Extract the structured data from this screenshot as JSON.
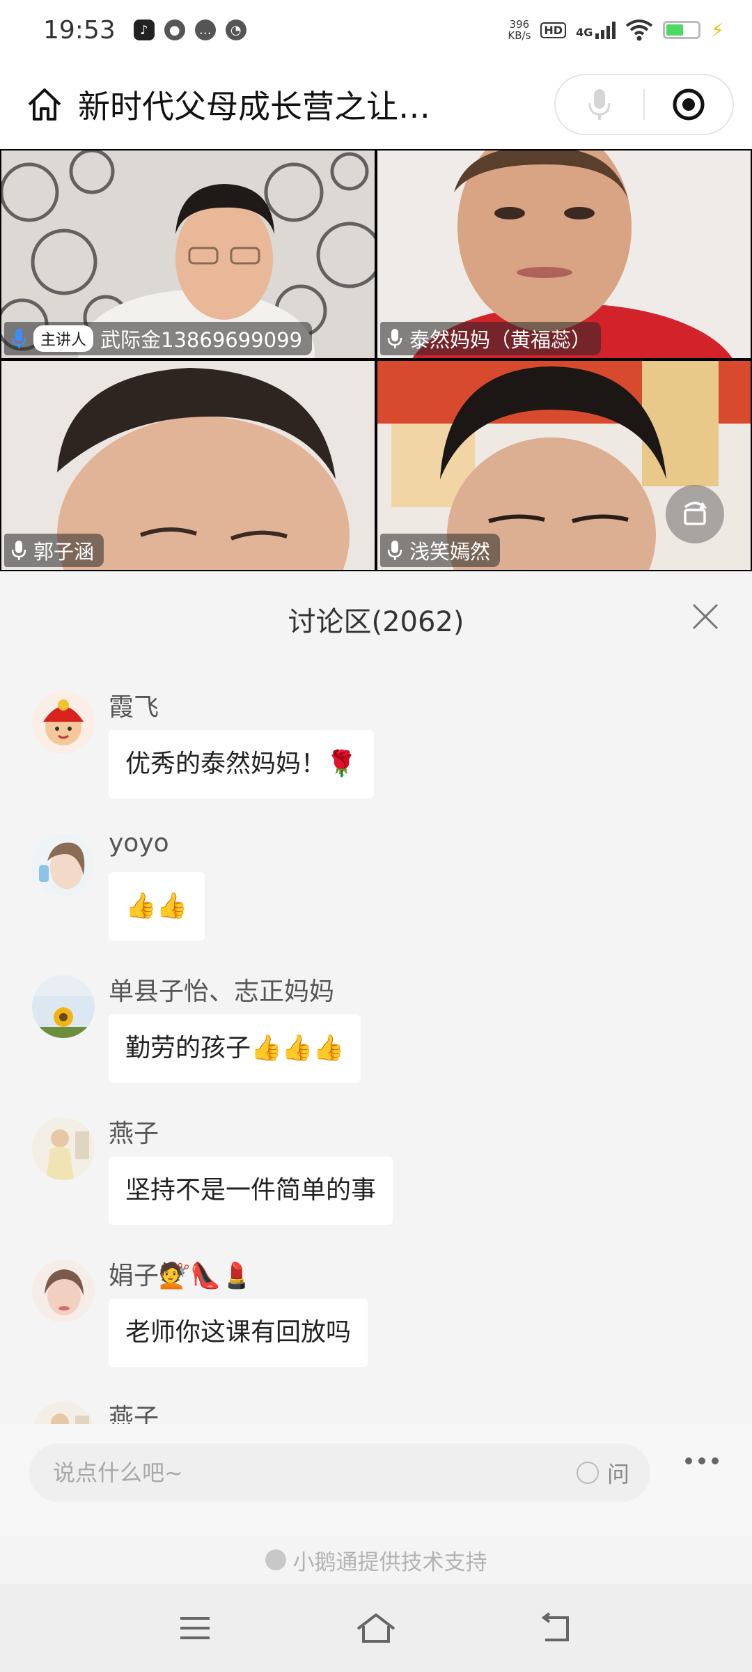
{
  "status": {
    "time": "19:53",
    "net_speed_value": "396",
    "net_speed_unit": "KB/s",
    "hd": "HD",
    "network": "4G"
  },
  "header": {
    "title": "新时代父母成长营之让…"
  },
  "video": {
    "host_badge": "主讲人",
    "tiles": [
      {
        "name": "武际金13869699099"
      },
      {
        "name": "泰然妈妈（黄福蕊）"
      },
      {
        "name": "郭子涵"
      },
      {
        "name": "浅笑嫣然"
      }
    ]
  },
  "discussion": {
    "title": "讨论区(2062)",
    "messages": [
      {
        "name": "霞飞",
        "text": "优秀的泰然妈妈！🌹"
      },
      {
        "name": "yoyo",
        "text": "👍👍"
      },
      {
        "name": "单县子怡、志正妈妈",
        "text": "勤劳的孩子👍👍👍"
      },
      {
        "name": "燕子",
        "text": "坚持不是一件简单的事"
      },
      {
        "name": "娟子💇👠💄",
        "text": "老师你这课有回放吗"
      },
      {
        "name": "燕子",
        "text": ""
      }
    ]
  },
  "input": {
    "placeholder": "说点什么吧~",
    "ask_label": "问"
  },
  "footer": {
    "powered_by": "小鹅通提供技术支持"
  },
  "colors": {
    "page_bg": "#f4f4f4",
    "bubble_bg": "#ffffff",
    "name_text": "#555555",
    "tag_bg": "rgba(40,40,40,0.55)"
  }
}
